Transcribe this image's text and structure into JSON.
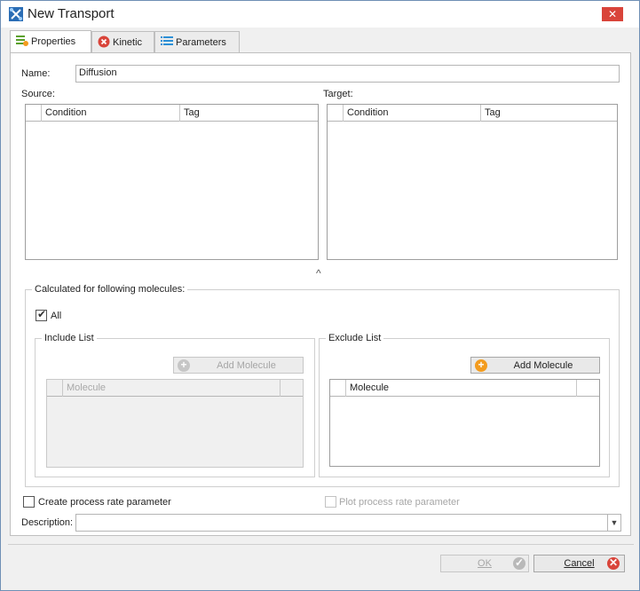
{
  "window": {
    "title": "New Transport",
    "close_glyph": "✕"
  },
  "tabs": [
    {
      "label": "Properties",
      "icon": "properties-icon"
    },
    {
      "label": "Kinetic",
      "icon": "kinetic-icon"
    },
    {
      "label": "Parameters",
      "icon": "parameters-icon"
    }
  ],
  "form": {
    "name_label": "Name:",
    "name_value": "Diffusion",
    "source_label": "Source:",
    "target_label": "Target:",
    "source_columns": [
      "Condition",
      "Tag"
    ],
    "target_columns": [
      "Condition",
      "Tag"
    ],
    "collapse_glyph": "^"
  },
  "molecules": {
    "group_title": "Calculated for following molecules:",
    "all_label": "All",
    "all_checked": true,
    "include_title": "Include List",
    "exclude_title": "Exclude List",
    "add_molecule_label": "Add Molecule",
    "molecule_column": "Molecule"
  },
  "options": {
    "create_rate_label": "Create process rate parameter",
    "plot_rate_label": "Plot process rate parameter",
    "description_label": "Description:",
    "description_value": ""
  },
  "buttons": {
    "ok_label": "OK",
    "cancel_label": "Cancel"
  },
  "colors": {
    "accent_orange": "#f39c1f",
    "close_red": "#d9443a",
    "disabled_gray": "#a6a6a6"
  }
}
